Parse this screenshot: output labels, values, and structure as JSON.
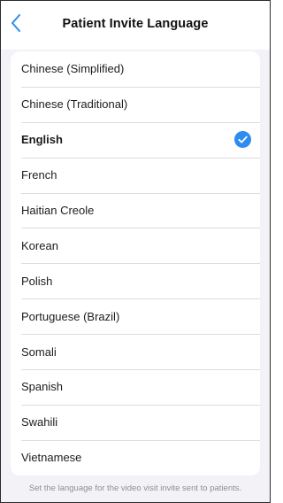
{
  "nav": {
    "title": "Patient Invite Language",
    "back_icon": "chevron-left-icon",
    "accent_color": "#2d8cf0"
  },
  "languages": [
    {
      "label": "Chinese (Simplified)",
      "selected": false
    },
    {
      "label": "Chinese (Traditional)",
      "selected": false
    },
    {
      "label": "English",
      "selected": true
    },
    {
      "label": "French",
      "selected": false
    },
    {
      "label": "Haitian Creole",
      "selected": false
    },
    {
      "label": "Korean",
      "selected": false
    },
    {
      "label": "Polish",
      "selected": false
    },
    {
      "label": "Portuguese (Brazil)",
      "selected": false
    },
    {
      "label": "Somali",
      "selected": false
    },
    {
      "label": "Spanish",
      "selected": false
    },
    {
      "label": "Swahili",
      "selected": false
    },
    {
      "label": "Vietnamese",
      "selected": false
    }
  ],
  "selected_icon": "checkmark-circle-icon",
  "footer": "Set the language for the video visit invite sent to patients."
}
